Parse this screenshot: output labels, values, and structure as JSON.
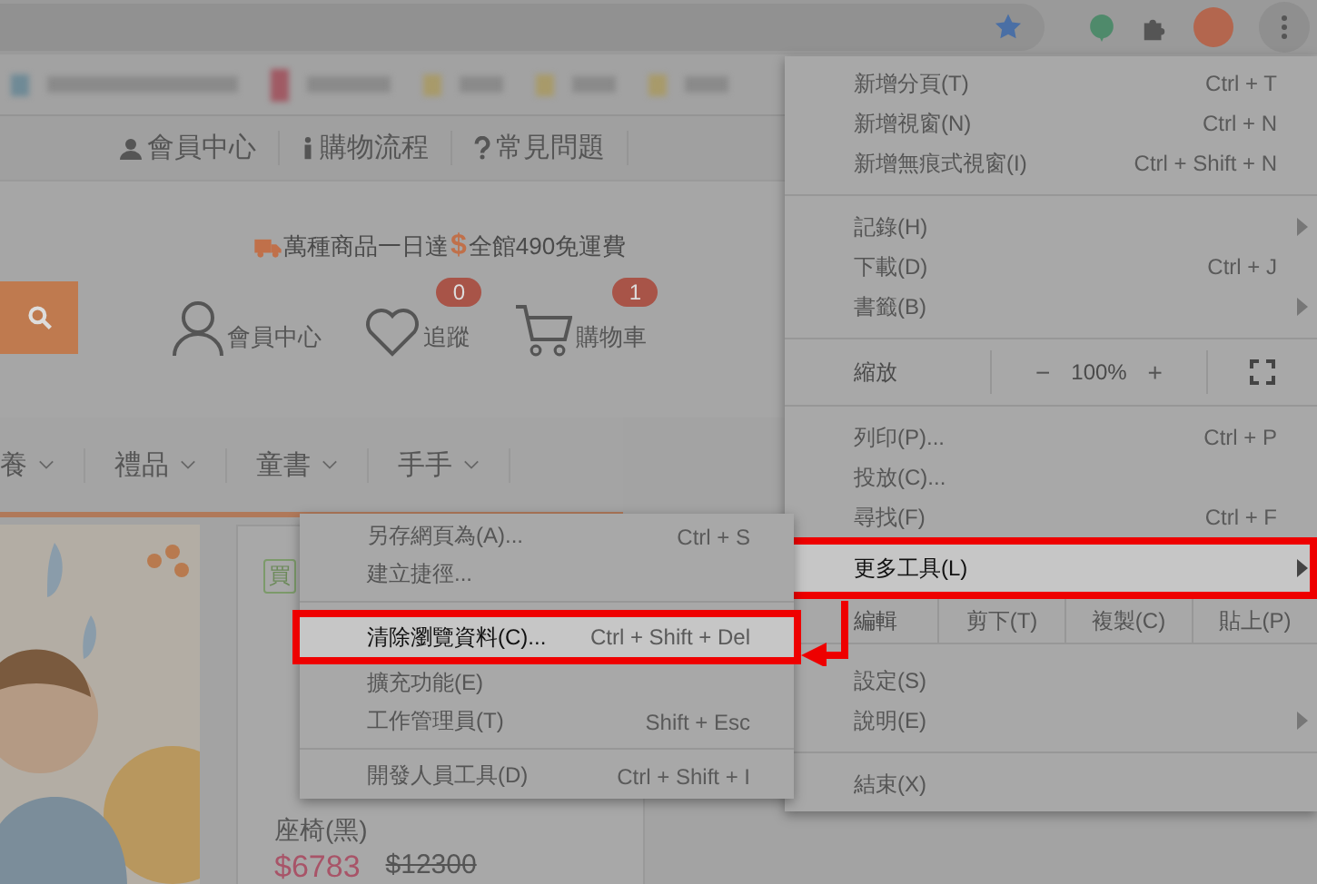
{
  "top_links": [
    {
      "label": "會員中心",
      "kind": "user"
    },
    {
      "label": "購物流程",
      "kind": "info"
    },
    {
      "label": "常見問題",
      "kind": "question"
    }
  ],
  "promo": {
    "part1": "萬種商品一日達",
    "dollar": "$",
    "part2": "全館490免運費"
  },
  "header_actions": [
    {
      "label": "會員中心",
      "kind": "user"
    },
    {
      "label": "追蹤",
      "kind": "heart",
      "badge": "0"
    },
    {
      "label": "購物車",
      "kind": "cart",
      "badge": "1"
    }
  ],
  "nav": [
    "養",
    "禮品",
    "童書",
    "手手"
  ],
  "product": {
    "tag": "買",
    "title": "座椅(黑)",
    "price": "$6783",
    "old_price": "$12300"
  },
  "menu": [
    {
      "kind": "item",
      "label": "新增分頁(T)",
      "shortcut": "Ctrl + T",
      "submenu": false,
      "selected": false
    },
    {
      "kind": "item",
      "label": "新增視窗(N)",
      "shortcut": "Ctrl + N",
      "submenu": false,
      "selected": false
    },
    {
      "kind": "item",
      "label": "新增無痕式視窗(I)",
      "shortcut": "Ctrl + Shift + N",
      "submenu": false,
      "selected": false
    },
    {
      "kind": "separator"
    },
    {
      "kind": "item",
      "label": "記錄(H)",
      "submenu": true,
      "selected": false
    },
    {
      "kind": "item",
      "label": "下載(D)",
      "shortcut": "Ctrl + J",
      "submenu": false,
      "selected": false
    },
    {
      "kind": "item",
      "label": "書籤(B)",
      "submenu": true,
      "selected": false
    },
    {
      "kind": "separator"
    },
    {
      "kind": "zoom",
      "label": "縮放",
      "minus": "−",
      "value": "100%",
      "plus": "+"
    },
    {
      "kind": "separator"
    },
    {
      "kind": "item",
      "label": "列印(P)...",
      "shortcut": "Ctrl + P",
      "submenu": false,
      "selected": false
    },
    {
      "kind": "item",
      "label": "投放(C)...",
      "submenu": false,
      "selected": false
    },
    {
      "kind": "item",
      "label": "尋找(F)",
      "shortcut": "Ctrl + F",
      "submenu": false,
      "selected": false
    },
    {
      "kind": "item",
      "label": "更多工具(L)",
      "submenu": true,
      "selected": true
    },
    {
      "kind": "edit",
      "label": "編輯",
      "actions": [
        "剪下(T)",
        "複製(C)",
        "貼上(P)"
      ]
    },
    {
      "kind": "item",
      "label": "設定(S)",
      "submenu": false,
      "selected": false
    },
    {
      "kind": "item",
      "label": "說明(E)",
      "submenu": true,
      "selected": false
    },
    {
      "kind": "separator"
    },
    {
      "kind": "item",
      "label": "結束(X)",
      "submenu": false,
      "selected": false
    }
  ],
  "submenu": [
    {
      "kind": "item",
      "label": "另存網頁為(A)...",
      "shortcut": "Ctrl + S",
      "selected": false
    },
    {
      "kind": "item",
      "label": "建立捷徑...",
      "selected": false
    },
    {
      "kind": "separator"
    },
    {
      "kind": "item",
      "label": "清除瀏覽資料(C)...",
      "shortcut": "Ctrl + Shift + Del",
      "selected": true
    },
    {
      "kind": "item",
      "label": "擴充功能(E)",
      "selected": false
    },
    {
      "kind": "item",
      "label": "工作管理員(T)",
      "shortcut": "Shift + Esc",
      "selected": false
    },
    {
      "kind": "separator"
    },
    {
      "kind": "item",
      "label": "開發人員工具(D)",
      "shortcut": "Ctrl + Shift + I",
      "selected": false
    }
  ]
}
